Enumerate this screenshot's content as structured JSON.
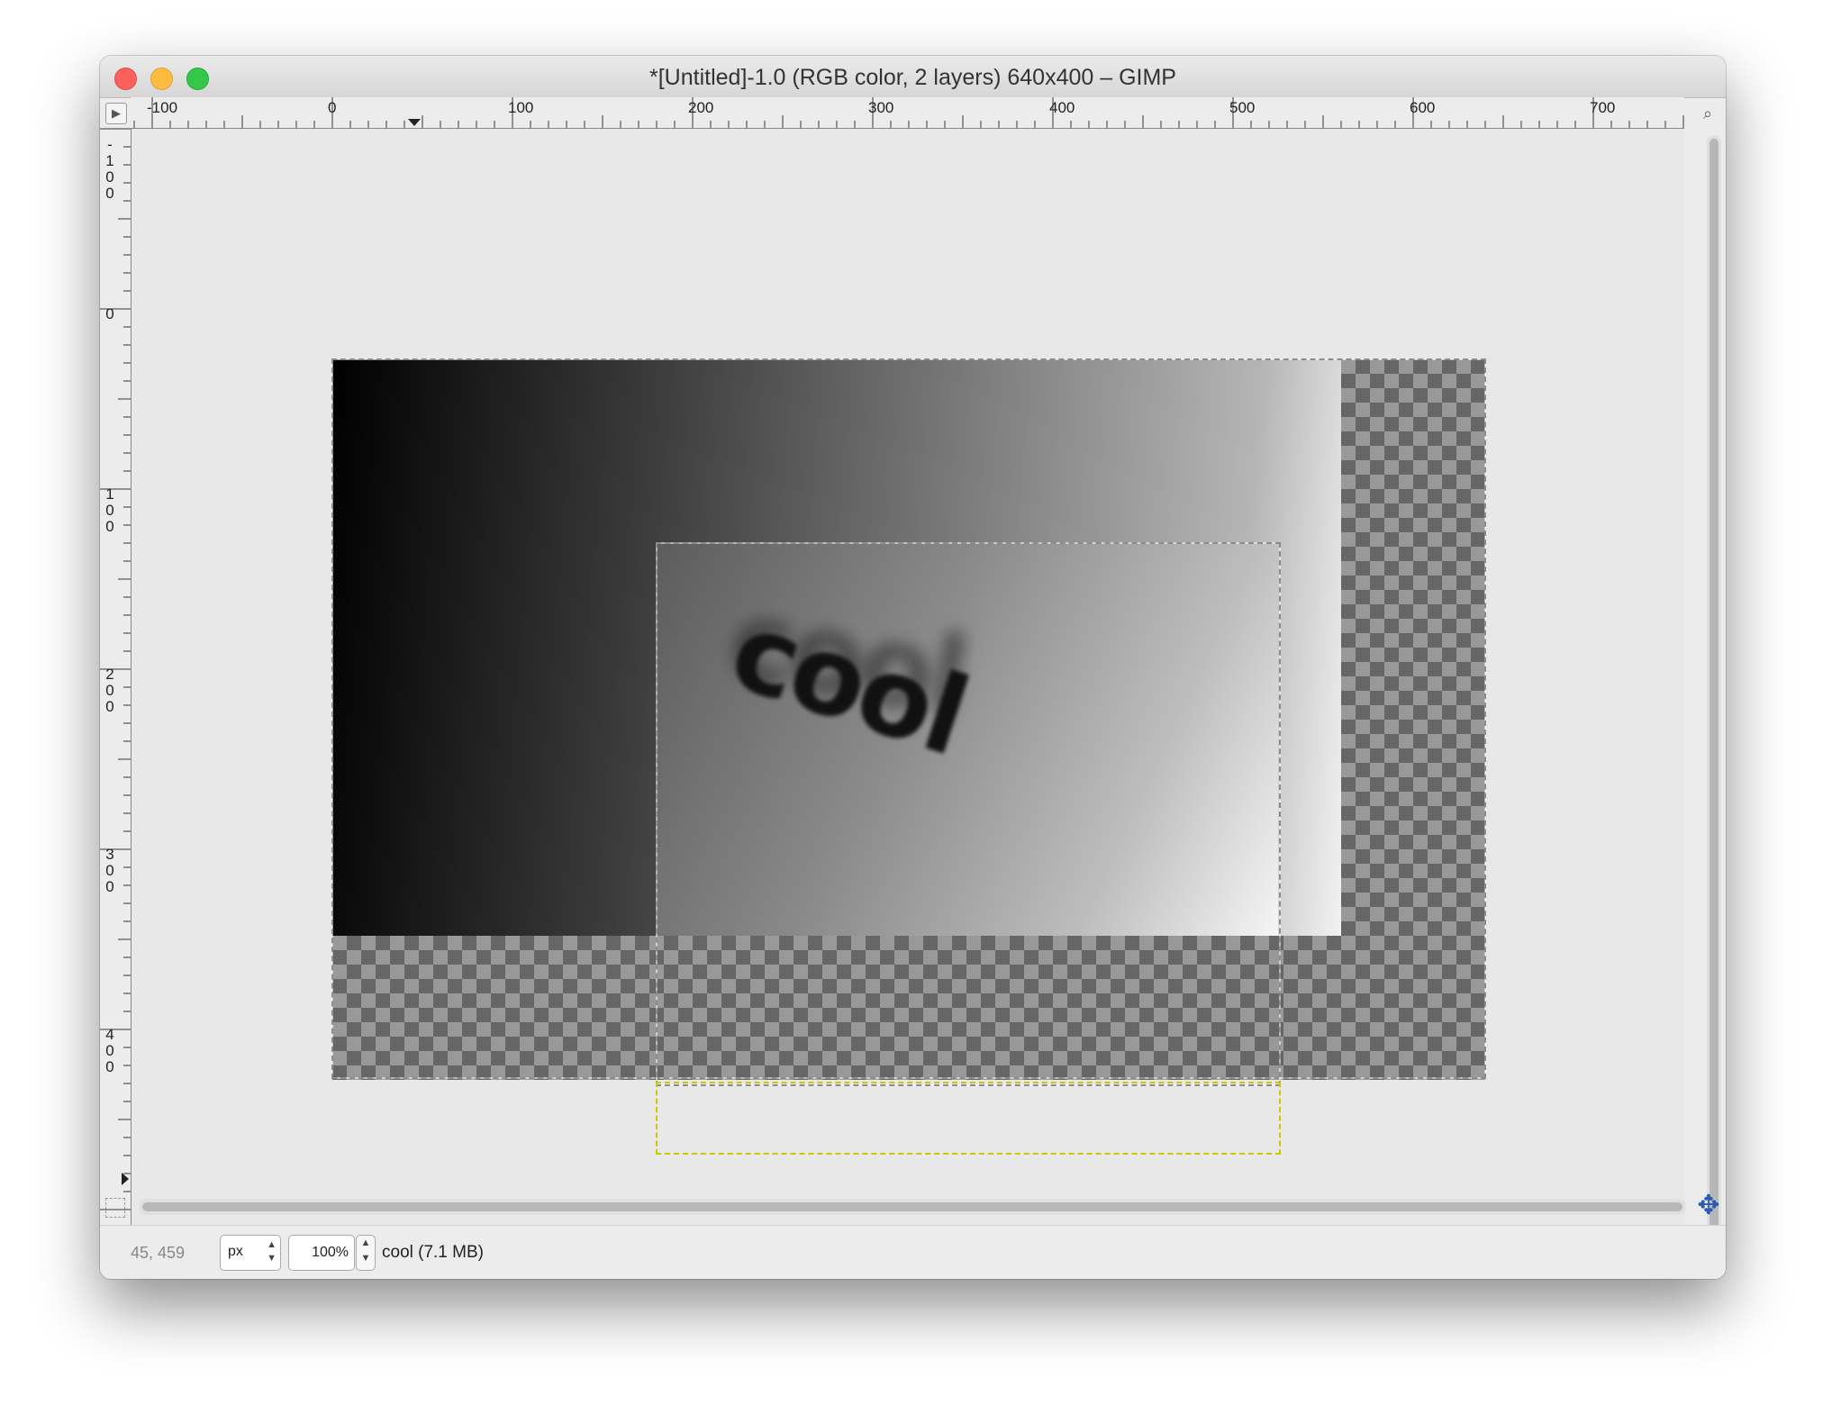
{
  "window": {
    "title": "*[Untitled]-1.0 (RGB color, 2 layers) 640x400 – GIMP",
    "controls": [
      "close",
      "minimize",
      "maximize"
    ]
  },
  "rulers": {
    "horizontal_labels": [
      "-100",
      "0",
      "100",
      "200",
      "300",
      "400",
      "500",
      "600",
      "700"
    ],
    "vertical_labels": [
      "-100",
      "0",
      "100",
      "200",
      "300",
      "400"
    ]
  },
  "canvas": {
    "layer_text": "cool"
  },
  "status": {
    "coords": "45, 459",
    "unit": "px",
    "zoom": "100%",
    "info": "cool (7.1 MB)"
  },
  "icons": {
    "menu": "triangle-right-icon",
    "zoom": "zoom-fit-icon",
    "quickmask": "quick-mask-icon",
    "navigate": "navigate-move-icon"
  },
  "colors": {
    "close": "#fc605c",
    "minimize": "#fdbc40",
    "maximize": "#34c84a",
    "selection_yellow": "#c9c900",
    "navigate_blue": "#2a5db0"
  }
}
